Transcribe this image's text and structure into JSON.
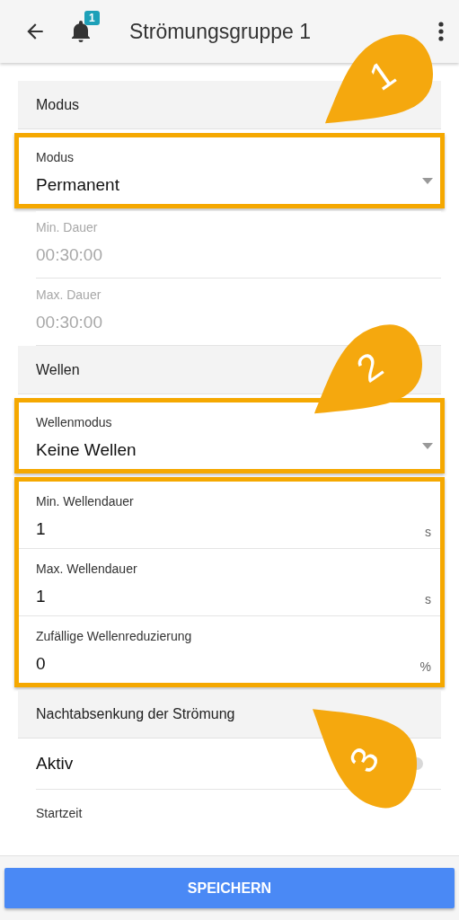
{
  "app_bar": {
    "title": "Strömungsgruppe 1",
    "notification_count": "1"
  },
  "sections": [
    {
      "title": "Modus",
      "groups": [
        {
          "highlighted": true,
          "fields": [
            {
              "kind": "select",
              "label": "Modus",
              "value": "Permanent",
              "disabled": false
            }
          ]
        },
        {
          "highlighted": false,
          "fields": [
            {
              "kind": "text",
              "label": "Min. Dauer",
              "value": "00:30:00",
              "disabled": true
            },
            {
              "kind": "text",
              "label": "Max. Dauer",
              "value": "00:30:00",
              "disabled": true
            }
          ]
        }
      ]
    },
    {
      "title": "Wellen",
      "groups": [
        {
          "highlighted": true,
          "fields": [
            {
              "kind": "select",
              "label": "Wellenmodus",
              "value": "Keine Wellen",
              "disabled": false
            }
          ]
        },
        {
          "highlighted": true,
          "fields": [
            {
              "kind": "text",
              "label": "Min. Wellendauer",
              "value": "1",
              "unit": "s",
              "disabled": false
            },
            {
              "kind": "text",
              "label": "Max. Wellendauer",
              "value": "1",
              "unit": "s",
              "disabled": false
            },
            {
              "kind": "text",
              "label": "Zufällige Wellenreduzierung",
              "value": "0",
              "unit": "%",
              "disabled": false
            }
          ]
        }
      ]
    },
    {
      "title": "Nachtabsenkung der Strömung",
      "groups": [
        {
          "highlighted": false,
          "fields": [
            {
              "kind": "switch",
              "label": "Aktiv",
              "on": false
            },
            {
              "kind": "time",
              "label": "Startzeit"
            }
          ]
        }
      ]
    }
  ],
  "save_button": "SPEICHERN",
  "callouts": [
    {
      "label": "1"
    },
    {
      "label": "2"
    },
    {
      "label": "3"
    }
  ]
}
